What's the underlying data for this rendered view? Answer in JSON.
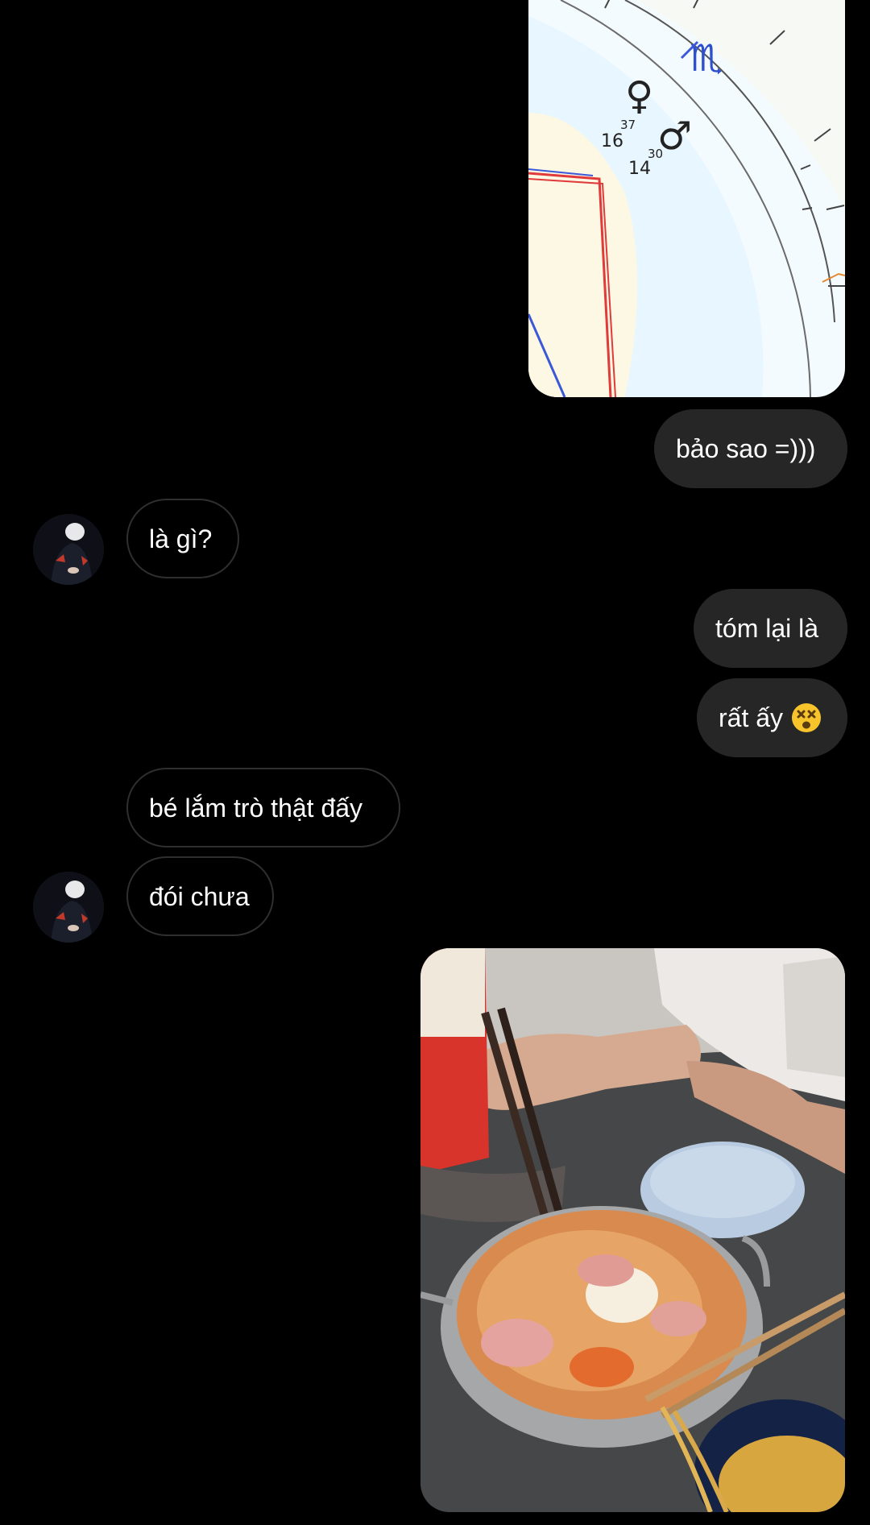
{
  "messages": [
    {
      "id": "m1",
      "side": "out",
      "type": "image",
      "image": "astrology-chart-photo"
    },
    {
      "id": "m2",
      "side": "out",
      "type": "text",
      "text": "bảo sao =)))"
    },
    {
      "id": "m3",
      "side": "in",
      "type": "text",
      "text": "là gì?"
    },
    {
      "id": "m4",
      "side": "out",
      "type": "text",
      "text": "tóm lại là"
    },
    {
      "id": "m5",
      "side": "out",
      "type": "text",
      "text": "rất ấy",
      "emoji": "dizzy-face-emoji"
    },
    {
      "id": "m6",
      "side": "in",
      "type": "text",
      "text": "bé lắm trò thật đấy"
    },
    {
      "id": "m7",
      "side": "in",
      "type": "text",
      "text": "đói chưa"
    },
    {
      "id": "m8",
      "side": "out",
      "type": "image",
      "image": "ramen-pot-photo"
    }
  ],
  "chart_photo_labels": {
    "degree_a": "16",
    "minute_a": "37",
    "degree_b": "14",
    "minute_b": "30"
  },
  "icons": {
    "venus": "♀",
    "mars": "♂",
    "scorpio": "♏"
  },
  "colors": {
    "background": "#000000",
    "outgoing_bubble": "#262626",
    "incoming_border": "#2f2f2f",
    "text": "#ffffff"
  }
}
